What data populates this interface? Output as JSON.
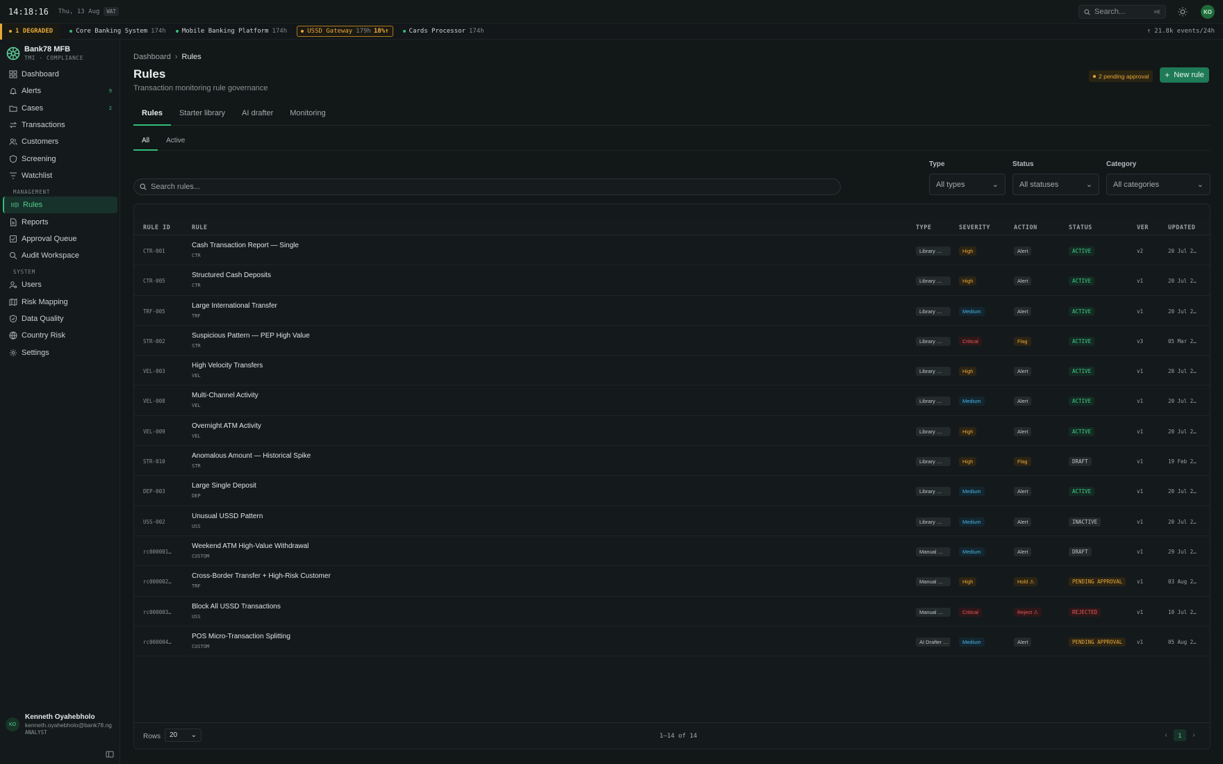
{
  "topbar": {
    "time": "14:18:16",
    "date": "Thu, 13 Aug",
    "tz": "WAT",
    "search_placeholder": "Search...",
    "search_shortcut": "⌘K",
    "avatar": "KO"
  },
  "statusbar": {
    "degraded": "1 DEGRADED",
    "services": [
      {
        "name": "Core Banking System",
        "hours": "174h",
        "state": "ok"
      },
      {
        "name": "Mobile Banking Platform",
        "hours": "174h",
        "state": "ok"
      },
      {
        "name": "USSD Gateway",
        "hours": "179h",
        "pct": "18%↑",
        "state": "warn"
      },
      {
        "name": "Cards Processor",
        "hours": "174h",
        "state": "ok"
      }
    ],
    "events": "↑ 21.8k events/24h",
    "colors": {
      "ok": "#2fbf77",
      "warn": "#e6a83a"
    }
  },
  "brand": {
    "name": "Bank78 MFB",
    "sub": "TMI · COMPLIANCE"
  },
  "nav": {
    "main": [
      {
        "label": "Dashboard",
        "icon": "grid-icon"
      },
      {
        "label": "Alerts",
        "icon": "bell-icon",
        "badge": "9"
      },
      {
        "label": "Cases",
        "icon": "folder-icon",
        "badge": "2"
      },
      {
        "label": "Transactions",
        "icon": "arrows-icon"
      },
      {
        "label": "Customers",
        "icon": "users-icon"
      },
      {
        "label": "Screening",
        "icon": "shield-icon"
      },
      {
        "label": "Watchlist",
        "icon": "filter-icon"
      }
    ],
    "management_label": "MANAGEMENT",
    "management": [
      {
        "label": "Rules",
        "icon": "rules-icon",
        "active": true
      },
      {
        "label": "Reports",
        "icon": "document-icon"
      },
      {
        "label": "Approval Queue",
        "icon": "check-square-icon"
      },
      {
        "label": "Audit Workspace",
        "icon": "search-icon"
      }
    ],
    "system_label": "SYSTEM",
    "system": [
      {
        "label": "Users",
        "icon": "user-gear-icon"
      },
      {
        "label": "Risk Mapping",
        "icon": "map-icon"
      },
      {
        "label": "Data Quality",
        "icon": "shield-check-icon"
      },
      {
        "label": "Country Risk",
        "icon": "globe-icon"
      },
      {
        "label": "Settings",
        "icon": "gear-icon"
      }
    ]
  },
  "user": {
    "initials": "KO",
    "name": "Kenneth Oyahebholo",
    "email": "kenneth.oyahebholo@bank78.ng",
    "role": "ANALYST"
  },
  "page": {
    "breadcrumb": [
      "Dashboard",
      "Rules"
    ],
    "title": "Rules",
    "subtitle": "Transaction monitoring rule governance",
    "pending": "2 pending approval",
    "new_rule": "New rule"
  },
  "tabs": [
    "Rules",
    "Starter library",
    "AI drafter",
    "Monitoring"
  ],
  "subtabs": [
    "All",
    "Active"
  ],
  "filters": {
    "search_placeholder": "Search rules...",
    "type": {
      "label": "Type",
      "value": "All types"
    },
    "status": {
      "label": "Status",
      "value": "All statuses"
    },
    "category": {
      "label": "Category",
      "value": "All categories"
    }
  },
  "table": {
    "headers": [
      "RULE ID",
      "RULE",
      "TYPE",
      "SEVERITY",
      "ACTION",
      "STATUS",
      "VER",
      "UPDATED"
    ],
    "rows": [
      {
        "id": "CTR-001",
        "name": "Cash Transaction Report — Single",
        "cat": "CTR",
        "type": "Library …",
        "severity": "High",
        "action": "Alert",
        "status": "ACTIVE",
        "ver": "v2",
        "updated": "20 Jul 2…"
      },
      {
        "id": "CTR-005",
        "name": "Structured Cash Deposits",
        "cat": "CTR",
        "type": "Library …",
        "severity": "High",
        "action": "Alert",
        "status": "ACTIVE",
        "ver": "v1",
        "updated": "20 Jul 2…"
      },
      {
        "id": "TRF-005",
        "name": "Large International Transfer",
        "cat": "TRF",
        "type": "Library …",
        "severity": "Medium",
        "action": "Alert",
        "status": "ACTIVE",
        "ver": "v1",
        "updated": "20 Jul 2…"
      },
      {
        "id": "STR-002",
        "name": "Suspicious Pattern — PEP High Value",
        "cat": "STR",
        "type": "Library …",
        "severity": "Critical",
        "action": "Flag",
        "status": "ACTIVE",
        "ver": "v3",
        "updated": "05 Mar 2…"
      },
      {
        "id": "VEL-003",
        "name": "High Velocity Transfers",
        "cat": "VEL",
        "type": "Library …",
        "severity": "High",
        "action": "Alert",
        "status": "ACTIVE",
        "ver": "v1",
        "updated": "20 Jul 2…"
      },
      {
        "id": "VEL-008",
        "name": "Multi-Channel Activity",
        "cat": "VEL",
        "type": "Library …",
        "severity": "Medium",
        "action": "Alert",
        "status": "ACTIVE",
        "ver": "v1",
        "updated": "20 Jul 2…"
      },
      {
        "id": "VEL-009",
        "name": "Overnight ATM Activity",
        "cat": "VEL",
        "type": "Library …",
        "severity": "High",
        "action": "Alert",
        "status": "ACTIVE",
        "ver": "v1",
        "updated": "20 Jul 2…"
      },
      {
        "id": "STR-010",
        "name": "Anomalous Amount — Historical Spike",
        "cat": "STR",
        "type": "Library …",
        "severity": "High",
        "action": "Flag",
        "status": "DRAFT",
        "ver": "v1",
        "updated": "19 Feb 2…"
      },
      {
        "id": "DEP-003",
        "name": "Large Single Deposit",
        "cat": "DEP",
        "type": "Library …",
        "severity": "Medium",
        "action": "Alert",
        "status": "ACTIVE",
        "ver": "v1",
        "updated": "20 Jul 2…"
      },
      {
        "id": "USS-002",
        "name": "Unusual USSD Pattern",
        "cat": "USS",
        "type": "Library …",
        "severity": "Medium",
        "action": "Alert",
        "status": "INACTIVE",
        "ver": "v1",
        "updated": "20 Jul 2…"
      },
      {
        "id": "rc000001…",
        "name": "Weekend ATM High-Value Withdrawal",
        "cat": "CUSTOM",
        "type": "Manual …",
        "severity": "Medium",
        "action": "Alert",
        "status": "DRAFT",
        "ver": "v1",
        "updated": "29 Jul 2…"
      },
      {
        "id": "rc000002…",
        "name": "Cross-Border Transfer + High-Risk Customer",
        "cat": "TRF",
        "type": "Manual …",
        "severity": "High",
        "action": "Hold ⚠",
        "status": "PENDING APPROVAL",
        "ver": "v1",
        "updated": "03 Aug 2…"
      },
      {
        "id": "rc000003…",
        "name": "Block All USSD Transactions",
        "cat": "USS",
        "type": "Manual …",
        "severity": "Critical",
        "action": "Reject ⚠",
        "status": "REJECTED",
        "ver": "v1",
        "updated": "10 Jul 2…"
      },
      {
        "id": "rc000004…",
        "name": "POS Micro-Transaction Splitting",
        "cat": "CUSTOM",
        "type": "AI Drafter …",
        "severity": "Medium",
        "action": "Alert",
        "status": "PENDING APPROVAL",
        "ver": "v1",
        "updated": "05 Aug 2…"
      }
    ]
  },
  "footer": {
    "rows_label": "Rows",
    "rows_value": "20",
    "count": "1–14 of 14",
    "page": "1"
  }
}
